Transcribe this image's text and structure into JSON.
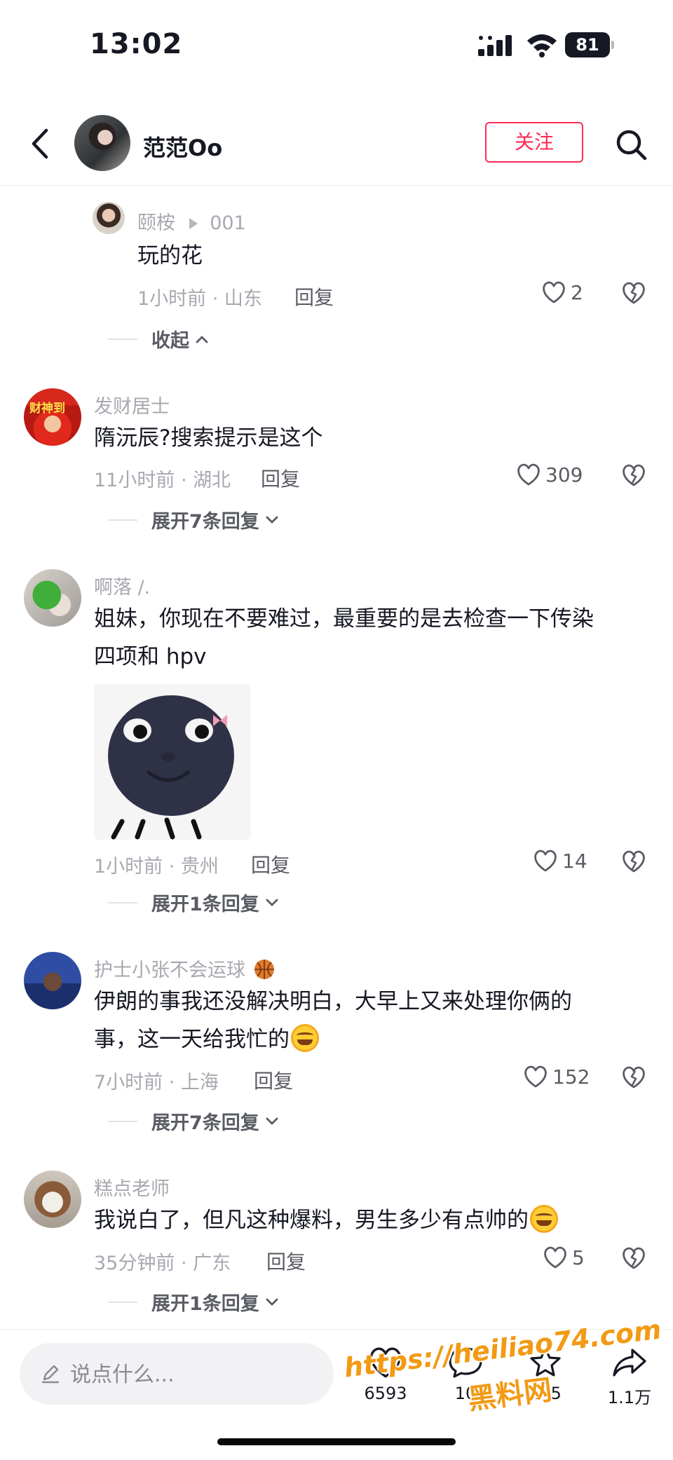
{
  "status_bar": {
    "time": "13:02",
    "battery": "81"
  },
  "header": {
    "name": "范范Oo",
    "follow_label": "关注"
  },
  "comments": [
    {
      "username": "颐桉",
      "reply_to": "001",
      "text": "玩的花",
      "meta": "1小时前 · 山东",
      "reply_label": "回复",
      "likes": "2",
      "collapse_label": "收起"
    },
    {
      "username": "发财居士",
      "text": "隋沅辰?搜索提示是这个",
      "meta": "11小时前 · 湖北",
      "reply_label": "回复",
      "likes": "309",
      "expand_label": "展开7条回复"
    },
    {
      "username": "啊落 /.",
      "text_line1": "姐妹，你现在不要难过，最重要的是去检查一下传染",
      "text_line2": "四项和 hpv",
      "meta": "1小时前 · 贵州",
      "reply_label": "回复",
      "likes": "14",
      "expand_label": "展开1条回复"
    },
    {
      "username": "护士小张不会运球",
      "text_line1": "伊朗的事我还没解决明白，大早上又来处理你俩的",
      "text_line2": "事，这一天给我忙的",
      "meta": "7小时前 · 上海",
      "reply_label": "回复",
      "likes": "152",
      "expand_label": "展开7条回复"
    },
    {
      "username": "糕点老师",
      "text": "我说白了，但凡这种爆料，男生多少有点帅的",
      "meta": "35分钟前 · 广东",
      "reply_label": "回复",
      "likes": "5",
      "expand_label": "展开1条回复"
    }
  ],
  "bottom_bar": {
    "input_placeholder": "说点什么...",
    "likes": "6593",
    "comments": "10",
    "favorites": "445",
    "shares": "1.1万"
  },
  "watermark": {
    "url": "https://heiliao74.com",
    "name": "黑料网"
  },
  "colors": {
    "accent": "#fe2c55",
    "text": "#161823",
    "secondary": "#a7a9af",
    "watermark": "#f29a14"
  }
}
